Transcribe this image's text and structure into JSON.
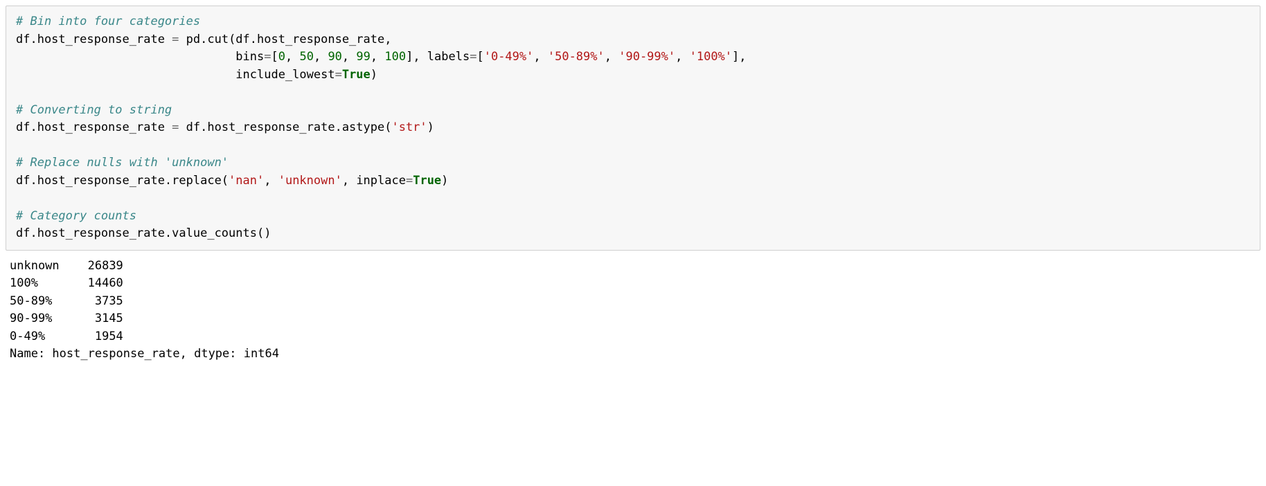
{
  "code": {
    "c1": "# Bin into four categories",
    "l2a": "df.host_response_rate ",
    "eq": "=",
    "l2b": " pd.cut(df.host_response_rate,",
    "indent": "                               ",
    "l3a": "bins",
    "l3b": "[",
    "n0": "0",
    "comma": ", ",
    "n50": "50",
    "n90": "90",
    "n99": "99",
    "n100": "100",
    "l3c": "], labels",
    "lb": "[",
    "s1": "'0-49%'",
    "s2": "'50-89%'",
    "s3": "'90-99%'",
    "s4": "'100%'",
    "rb": "],",
    "l4a": "include_lowest",
    "true": "True",
    "rp": ")",
    "blank": "",
    "c2": "# Converting to string",
    "l6a": "df.host_response_rate ",
    "l6b": " df.host_response_rate.astype(",
    "s_str": "'str'",
    "c3": "# Replace nulls with 'unknown'",
    "l8a": "df.host_response_rate.replace(",
    "s_nan": "'nan'",
    "s_unk": "'unknown'",
    "l8b": ", inplace",
    "c4": "# Category counts",
    "l10": "df.host_response_rate.value_counts()"
  },
  "output": {
    "rows": [
      {
        "label": "unknown",
        "count": "26839"
      },
      {
        "label": "100%",
        "count": "14460"
      },
      {
        "label": "50-89%",
        "count": " 3735"
      },
      {
        "label": "90-99%",
        "count": " 3145"
      },
      {
        "label": "0-49%",
        "count": " 1954"
      }
    ],
    "footer": "Name: host_response_rate, dtype: int64"
  }
}
